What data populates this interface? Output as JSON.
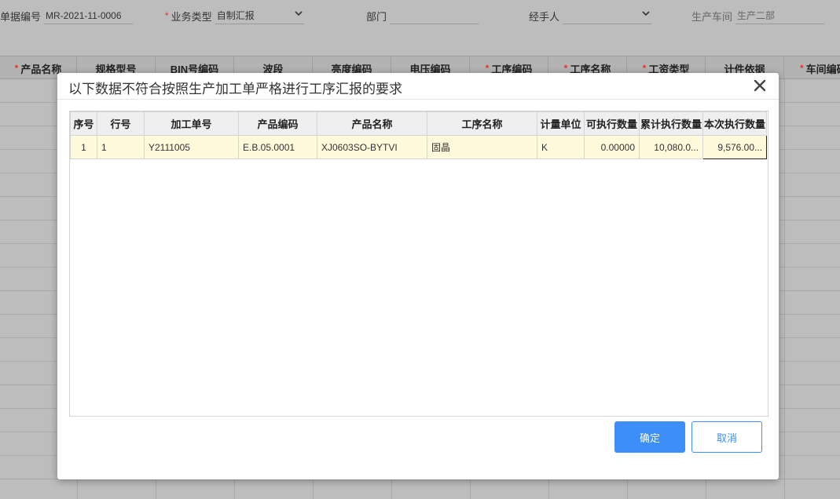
{
  "form": {
    "doc_no_label": "单据编号",
    "doc_no_value": "MR-2021-11-0006",
    "biz_type_label": "业务类型",
    "biz_type_value": "自制汇报",
    "dept_label": "部门",
    "dept_value": "",
    "handler_label": "经手人",
    "handler_value": "",
    "workshop_label": "生产车间",
    "workshop_value": "生产二部"
  },
  "grid": {
    "columns": [
      {
        "label": "产品名称",
        "required": true
      },
      {
        "label": "规格型号",
        "required": false
      },
      {
        "label": "BIN号编码",
        "required": false
      },
      {
        "label": "波段",
        "required": false
      },
      {
        "label": "亮度编码",
        "required": false
      },
      {
        "label": "电压编码",
        "required": false
      },
      {
        "label": "工序编码",
        "required": true
      },
      {
        "label": "工序名称",
        "required": true
      },
      {
        "label": "工资类型",
        "required": true
      },
      {
        "label": "计件依据",
        "required": false
      },
      {
        "label": "车间编码",
        "required": true
      }
    ]
  },
  "modal": {
    "title": "以下数据不符合按照生产加工单严格进行工序汇报的要求",
    "columns": [
      "序号",
      "行号",
      "加工单号",
      "产品编码",
      "产品名称",
      "工序名称",
      "计量单位",
      "可执行数量",
      "累计执行数量",
      "本次执行数量"
    ],
    "rows": [
      [
        "1",
        "1",
        "Y2111005",
        "E.B.05.0001",
        "XJ0603SO-BYTVI",
        "固晶",
        "K",
        "0.00000",
        "10,080.0...",
        "9,576.00..."
      ]
    ],
    "ok_label": "确定",
    "cancel_label": "取消"
  },
  "colors": {
    "primary": "#3d8ef6",
    "row_highlight": "#fff9db",
    "required": "#e5322d"
  }
}
